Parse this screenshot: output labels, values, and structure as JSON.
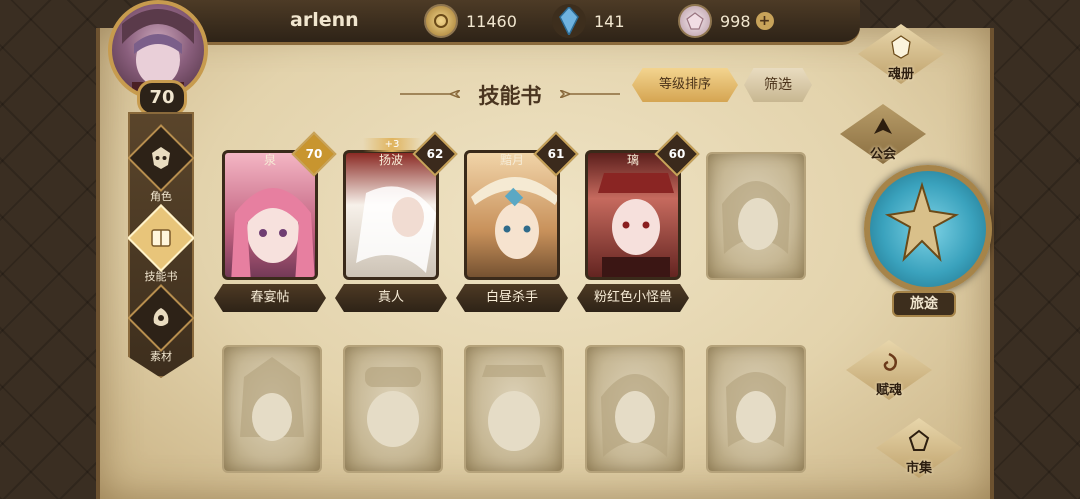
{
  "player": {
    "name": "arlenn",
    "level": "70"
  },
  "currencies": [
    {
      "icon": "gold-coin-icon",
      "value": "11460",
      "color": "#d6b160"
    },
    {
      "icon": "blue-crystal-icon",
      "value": "141",
      "color": "#6fb3e0"
    },
    {
      "icon": "pink-gem-icon",
      "value": "998",
      "color": "#e3c8d2",
      "plus": "+"
    }
  ],
  "left_nav": [
    {
      "label": "角色",
      "icon": "character-mask-icon"
    },
    {
      "label": "技能书",
      "icon": "skill-book-icon",
      "active": true
    },
    {
      "label": "素材",
      "icon": "material-icon"
    }
  ],
  "page": {
    "title": "技能书"
  },
  "buttons": {
    "sort": "等级排序",
    "filter": "筛选"
  },
  "cards": [
    {
      "top_name": "泉",
      "level": "70",
      "name": "春宴帖",
      "level_color": "#c8952f",
      "art": [
        "#f4b6c4",
        "#c0607f",
        "#6a3552"
      ]
    },
    {
      "top_name": "扬波",
      "level": "62",
      "name": "真人",
      "badge": "+3",
      "level_color": "#3b2a1c",
      "art": [
        "#f7f1ea",
        "#c9bfb1",
        "#7a2f2a"
      ]
    },
    {
      "top_name": "黯月",
      "level": "61",
      "name": "白昼杀手",
      "level_color": "#3b2a1c",
      "art": [
        "#f1d4a8",
        "#c8915b",
        "#6b4a2c"
      ]
    },
    {
      "top_name": "璃",
      "level": "60",
      "name": "粉红色小怪兽",
      "level_color": "#3b2a1c",
      "art": [
        "#f6e0dc",
        "#c66a5e",
        "#5c1f1c"
      ]
    }
  ],
  "right_nav": [
    {
      "label": "魂册",
      "icon": "soul-book-icon"
    },
    {
      "label": "公会",
      "icon": "guild-icon"
    },
    {
      "label": "旅途",
      "icon": "journey-emblem-icon"
    },
    {
      "label": "赋魂",
      "icon": "swirl-soul-icon"
    },
    {
      "label": "市集",
      "icon": "market-gem-icon"
    }
  ]
}
